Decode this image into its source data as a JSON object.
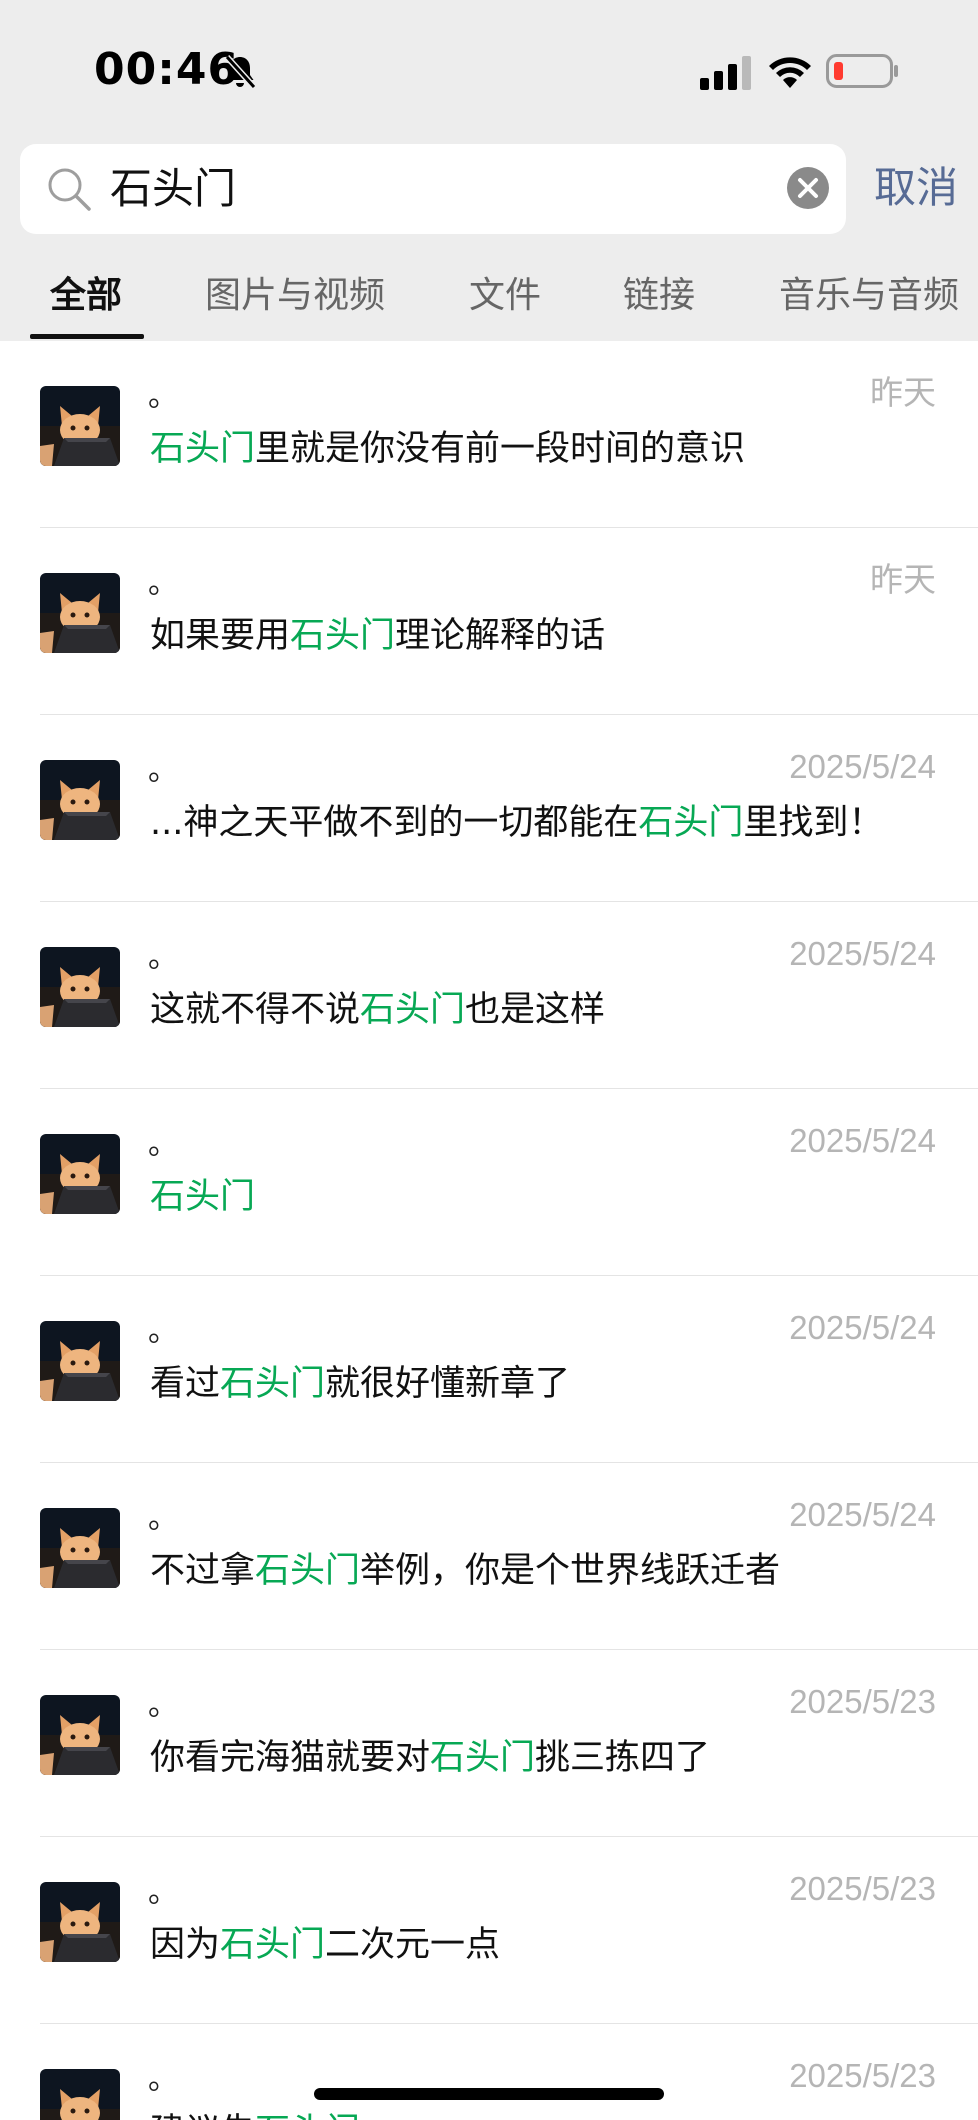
{
  "status_bar": {
    "time": "00:46",
    "icons": [
      "bell-muted-icon",
      "cellular-signal-icon",
      "wifi-icon",
      "battery-low-icon"
    ],
    "battery_color": "#ff3b30"
  },
  "search": {
    "value": "石头门",
    "cancel_label": "取消",
    "icon": "search-icon",
    "clear_icon": "clear-icon"
  },
  "tabs": [
    {
      "label": "全部",
      "active": true
    },
    {
      "label": "图片与视频",
      "active": false
    },
    {
      "label": "文件",
      "active": false
    },
    {
      "label": "链接",
      "active": false
    },
    {
      "label": "音乐与音频",
      "active": false
    }
  ],
  "colors": {
    "highlight": "#07a854",
    "cancel": "#576b95",
    "header_bg": "#ededed"
  },
  "results": [
    {
      "sender": "。",
      "date": "昨天",
      "pre": "",
      "keyword": "石头门",
      "post": "里就是你没有前一段时间的意识"
    },
    {
      "sender": "。",
      "date": "昨天",
      "pre": "如果要用",
      "keyword": "石头门",
      "post": "理论解释的话"
    },
    {
      "sender": "。",
      "date": "2025/5/24",
      "pre": "...神之天平做不到的一切都能在",
      "keyword": "石头门",
      "post": "里找到！"
    },
    {
      "sender": "。",
      "date": "2025/5/24",
      "pre": "这就不得不说",
      "keyword": "石头门",
      "post": "也是这样"
    },
    {
      "sender": "。",
      "date": "2025/5/24",
      "pre": "",
      "keyword": "石头门",
      "post": ""
    },
    {
      "sender": "。",
      "date": "2025/5/24",
      "pre": "看过",
      "keyword": "石头门",
      "post": "就很好懂新章了"
    },
    {
      "sender": "。",
      "date": "2025/5/24",
      "pre": "不过拿",
      "keyword": "石头门",
      "post": "举例，你是个世界线跃迁者"
    },
    {
      "sender": "。",
      "date": "2025/5/23",
      "pre": "你看完海猫就要对",
      "keyword": "石头门",
      "post": "挑三拣四了"
    },
    {
      "sender": "。",
      "date": "2025/5/23",
      "pre": "因为",
      "keyword": "石头门",
      "post": "二次元一点"
    },
    {
      "sender": "。",
      "date": "2025/5/23",
      "pre": "建议先",
      "keyword": "石头门",
      "post": ""
    }
  ]
}
